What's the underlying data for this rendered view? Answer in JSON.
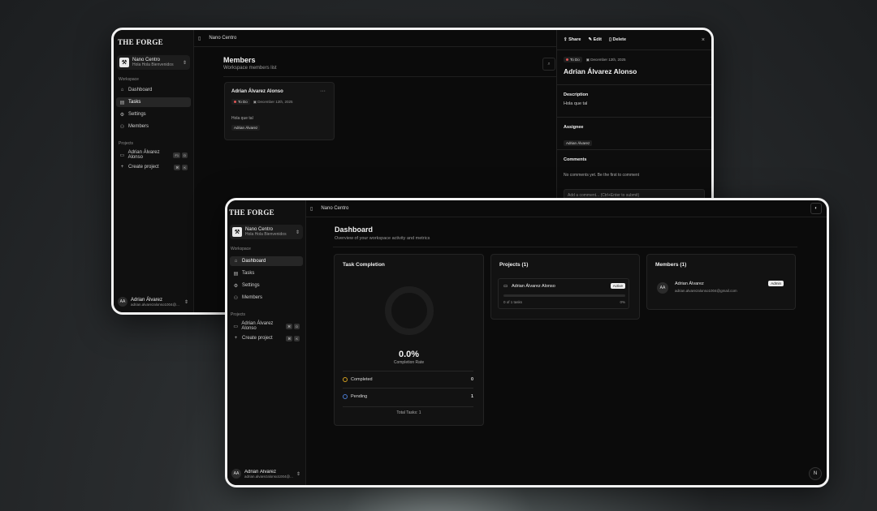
{
  "back": {
    "brand": "THE FORGE",
    "workspace": {
      "name": "Nano Centro",
      "subtitle": "Hola Hola Bienvenidos"
    },
    "sections": {
      "workspace": "Workspace",
      "projects": "Projects"
    },
    "nav": [
      {
        "label": "Dashboard",
        "icon": "home-icon"
      },
      {
        "label": "Tasks",
        "icon": "clipboard-icon"
      },
      {
        "label": "Settings",
        "icon": "gear-icon"
      },
      {
        "label": "Members",
        "icon": "users-icon"
      }
    ],
    "project": {
      "label": "Adrian Álvarez Alonso",
      "pill_a": "F1",
      "pill_b": "D"
    },
    "create_project": {
      "label": "Create project",
      "pill_a": "⌘",
      "pill_b": "K"
    },
    "user": {
      "initials": "AA",
      "name": "Adrian Álvarez",
      "email": "adrian.alvarezalonso1004@..."
    },
    "topbar_title": "Nano Centro",
    "page_title": "Members",
    "page_subtitle": "Workspace members list",
    "task_card": {
      "title": "Adrian Álvarez Alonso",
      "menu": "···",
      "status": "To Do",
      "date": "December 12th, 2025",
      "description": "Hola que tal",
      "assignee": "Adrian Álvarez"
    },
    "detail": {
      "share": "Share",
      "edit": "Edit",
      "delete": "Delete",
      "close": "×",
      "status": "To Do",
      "date": "December 12th, 2025",
      "title": "Adrian Álvarez Alonso",
      "description_label": "Description",
      "description": "Hola que tal",
      "assignee_label": "Assignee",
      "assignee": "Adrian Álvarez",
      "comments_label": "Comments",
      "comments_empty": "No comments yet. Be the first to comment",
      "comment_placeholder": "Add a comment... (Ctrl+Enter to submit)"
    }
  },
  "front": {
    "brand": "THE FORGE",
    "workspace": {
      "name": "Nano Centro",
      "subtitle": "Hola Hola Bienvenidos"
    },
    "sections": {
      "workspace": "Workspace",
      "projects": "Projects"
    },
    "nav": [
      {
        "label": "Dashboard",
        "icon": "home-icon"
      },
      {
        "label": "Tasks",
        "icon": "clipboard-icon"
      },
      {
        "label": "Settings",
        "icon": "gear-icon"
      },
      {
        "label": "Members",
        "icon": "users-icon"
      }
    ],
    "project": {
      "label": "Adrian Álvarez Alonso",
      "pill_a": "⌘",
      "pill_b": "D"
    },
    "create_project": {
      "label": "Create project",
      "pill_a": "⌘",
      "pill_b": "K"
    },
    "user": {
      "initials": "AA",
      "name": "Adrian Álvarez",
      "email": "adrian.alvarezalonso1004@..."
    },
    "topbar_title": "Nano Centro",
    "page_title": "Dashboard",
    "page_subtitle": "Overview of your workspace activity and metrics",
    "task_completion": {
      "title": "Task Completion",
      "percent": "0.0%",
      "percent_value": 0,
      "rate_label": "Completion Rate",
      "completed_label": "Completed",
      "completed_value": "0",
      "pending_label": "Pending",
      "pending_value": "1",
      "total": "Total Tasks: 1"
    },
    "projects_card": {
      "title": "Projects (1)",
      "name": "Adrian Álvarez Alonso",
      "status": "Active",
      "tasks": "0 of 1 tasks",
      "percent": "0%",
      "progress": 0
    },
    "members_card": {
      "title": "Members (1)",
      "initials": "AA",
      "name": "Adrian Álvarez",
      "email": "adrian.alvarezalonso1004@gmail.com",
      "role": "Admin"
    },
    "corner_badge": "N"
  }
}
